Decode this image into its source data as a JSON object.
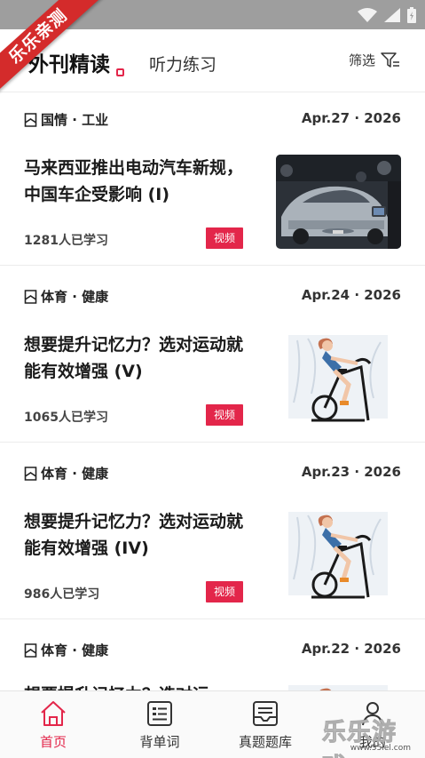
{
  "ribbon": {
    "text": "乐乐亲测"
  },
  "header": {
    "active_tab": "外刊精读",
    "inactive_tab": "听力练习",
    "filter_label": "筛选"
  },
  "articles": [
    {
      "tag": "国情 · 工业",
      "date": "Apr.27 · 2026",
      "title": "马来西亚推出电动汽车新规，中国车企受影响 (I)",
      "learners": "1281人已学习",
      "badge": "视频",
      "thumb": "car-show-photo"
    },
    {
      "tag": "体育 · 健康",
      "date": "Apr.24 · 2026",
      "title": "想要提升记忆力？选对运动就能有效增强 (V)",
      "learners": "1065人已学习",
      "badge": "视频",
      "thumb": "exercise-bike-illustration"
    },
    {
      "tag": "体育 · 健康",
      "date": "Apr.23 · 2026",
      "title": "想要提升记忆力？选对运动就能有效增强 (IV)",
      "learners": "986人已学习",
      "badge": "视频",
      "thumb": "exercise-bike-illustration"
    },
    {
      "tag": "体育 · 健康",
      "date": "Apr.22 · 2026",
      "title": "想要提升记忆力？选对运",
      "learners": "",
      "badge": "",
      "thumb": "exercise-bike-illustration"
    }
  ],
  "bottom_nav": [
    {
      "label": "首页",
      "icon": "home-icon",
      "active": true
    },
    {
      "label": "背单词",
      "icon": "word-card-icon",
      "active": false
    },
    {
      "label": "真题题库",
      "icon": "question-bank-icon",
      "active": false
    },
    {
      "label": "我的",
      "icon": "profile-icon",
      "active": false
    }
  ],
  "watermark": {
    "text": "乐乐游戏",
    "sub": "www.55lel.com"
  },
  "colors": {
    "accent": "#e3264a",
    "ribbon": "#d42b2b",
    "status_bar": "#9e9e9e"
  }
}
